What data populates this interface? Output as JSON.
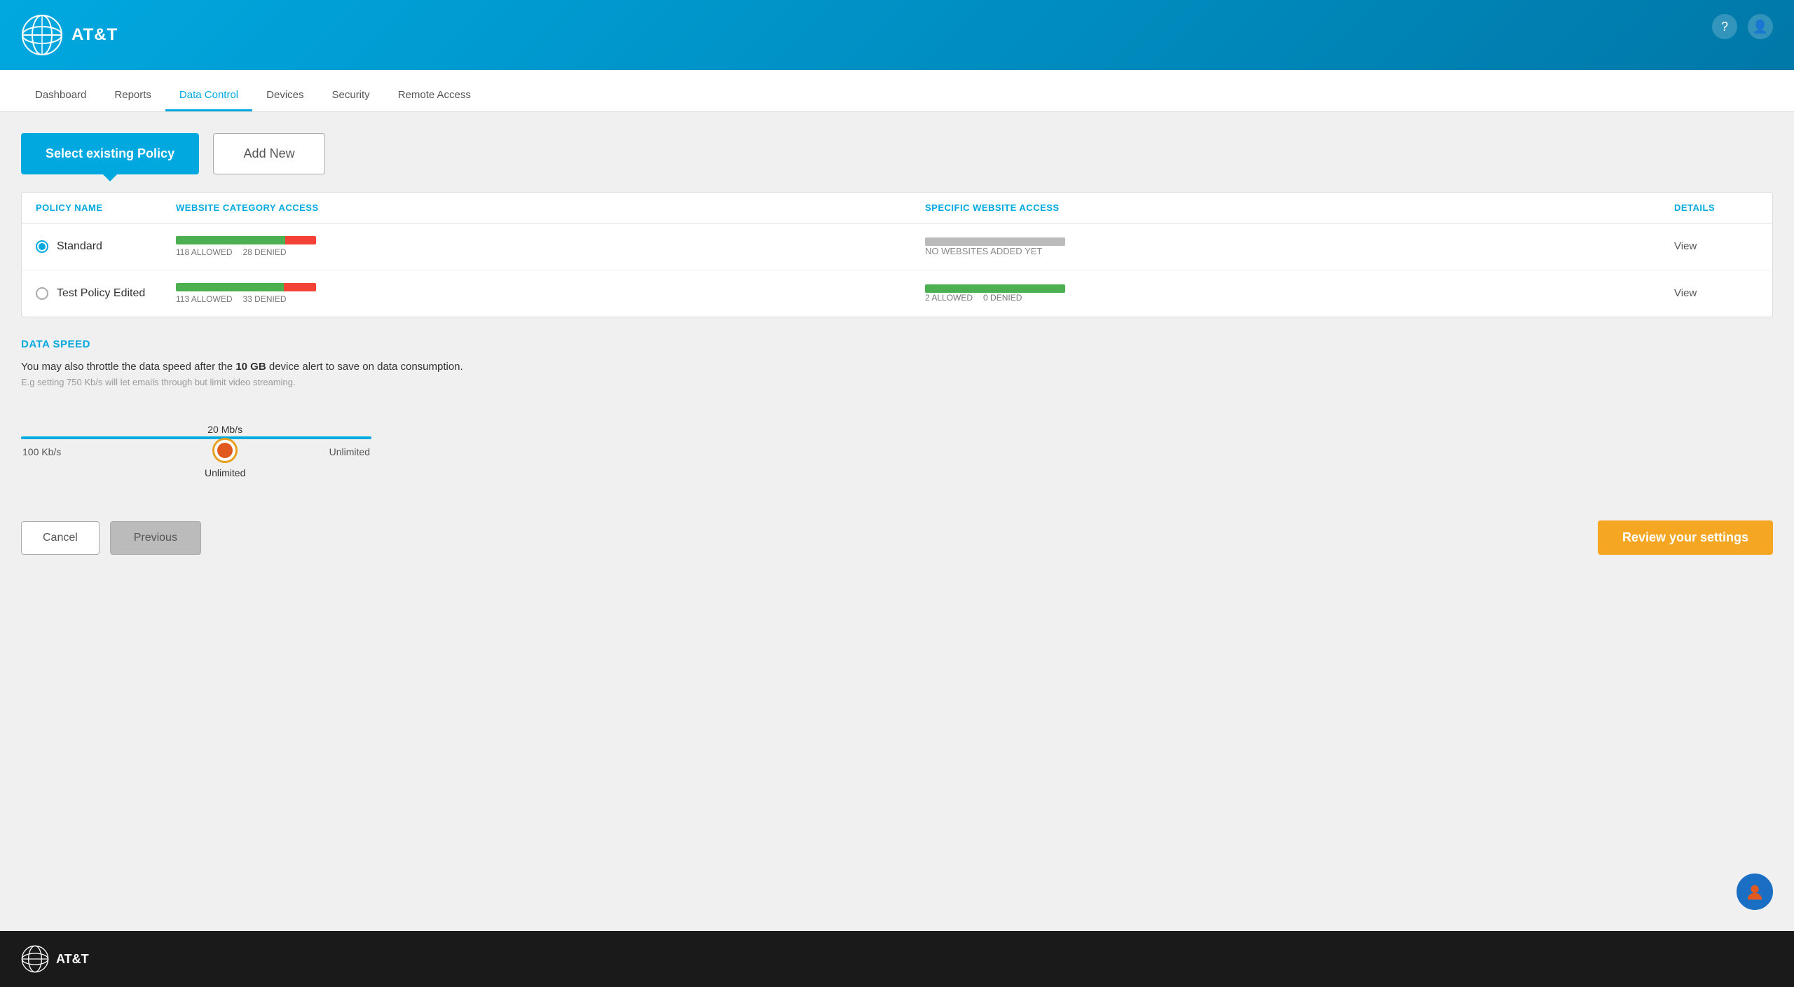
{
  "header": {
    "logo_text": "AT&T",
    "help_icon": "?",
    "user_icon": "👤"
  },
  "nav": {
    "items": [
      {
        "label": "Dashboard",
        "active": false
      },
      {
        "label": "Reports",
        "active": false
      },
      {
        "label": "Data Control",
        "active": true
      },
      {
        "label": "Devices",
        "active": false
      },
      {
        "label": "Security",
        "active": false
      },
      {
        "label": "Remote Access",
        "active": false
      }
    ]
  },
  "policy_buttons": {
    "select_label": "Select existing Policy",
    "add_new_label": "Add New"
  },
  "policy_table": {
    "headers": {
      "policy_name": "POLICY NAME",
      "website_category": "WEBSITE CATEGORY ACCESS",
      "specific_website": "SPECIFIC WEBSITE ACCESS",
      "details": "DETAILS"
    },
    "rows": [
      {
        "name": "Standard",
        "selected": true,
        "category_allowed": 118,
        "category_denied": 28,
        "category_allowed_label": "118 ALLOWED",
        "category_denied_label": "28 DENIED",
        "specific_label": "NO WEBSITES ADDED YET",
        "specific_type": "none",
        "view_label": "View"
      },
      {
        "name": "Test Policy Edited",
        "selected": false,
        "category_allowed": 113,
        "category_denied": 33,
        "category_allowed_label": "113 ALLOWED",
        "category_denied_label": "33 DENIED",
        "specific_allowed": 2,
        "specific_denied": 0,
        "specific_allowed_label": "2 ALLOWED",
        "specific_denied_label": "0 DENIED",
        "specific_type": "bar",
        "view_label": "View"
      }
    ]
  },
  "data_speed": {
    "title": "DATA SPEED",
    "description_pre": "You may also throttle the data speed after the ",
    "description_bold": "10 GB",
    "description_post": " device alert to save on data consumption.",
    "example": "E.g setting 750 Kb/s will let emails through but limit video streaming.",
    "slider_value": "20 Mb/s",
    "slider_min": "100 Kb/s",
    "slider_max": "Unlimited",
    "slider_label_below": "Unlimited"
  },
  "actions": {
    "cancel_label": "Cancel",
    "previous_label": "Previous",
    "review_label": "Review your settings"
  },
  "footer": {
    "logo_text": "AT&T"
  }
}
